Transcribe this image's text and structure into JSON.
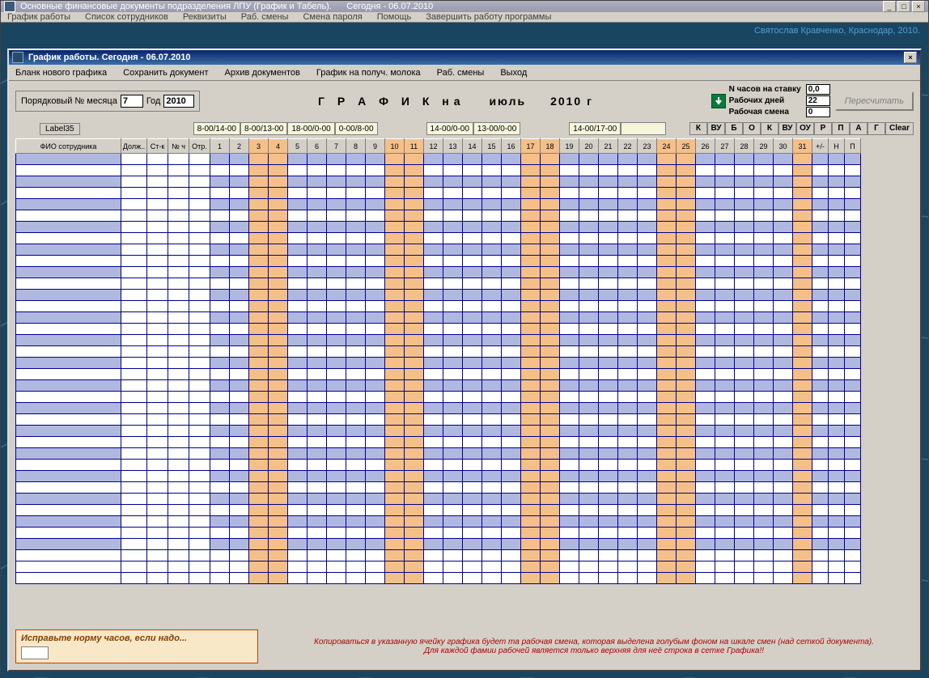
{
  "outer": {
    "title": "Основные финансовые документы подразделения ЛПУ (График и Табель).",
    "date_label": "Сегодня - 06.07.2010",
    "menu": [
      "График работы",
      "Список сотрудников",
      "Реквизиты",
      "Раб. смены",
      "Смена пароля",
      "Помощь",
      "Завершить работу программы"
    ]
  },
  "credit": "Святослав Кравченко, Краснодар, 2010.",
  "inner": {
    "title": "График работы.    Сегодня - 06.07.2010",
    "menu": [
      "Бланк нового графика",
      "Сохранить документ",
      "Архив документов",
      "График на получ. молока",
      "Раб. смены",
      "Выход"
    ]
  },
  "fields": {
    "month_label": "Порядковый № месяца",
    "month_value": "7",
    "year_label": "Год",
    "year_value": "2010",
    "main_title": "Г Р А Ф И К  на",
    "month_name": "июль",
    "year_text": "2010 г"
  },
  "stats": {
    "hours_label": "N часов на ставку",
    "hours_value": "0,0",
    "days_label": "Рабочих дней",
    "days_value": "22",
    "shift_label": "Рабочая смена",
    "shift_value": "0"
  },
  "recalc": "Пересчитать",
  "label35": "Label35",
  "shifts": [
    "8-00/14-00",
    "8-00/13-00",
    "18-00/0-00",
    "0-00/8-00",
    "14-00/0-00",
    "13-00/0-00",
    "14-00/17-00"
  ],
  "codes": [
    "К",
    "ВУ",
    "Б",
    "О",
    "К",
    "ВУ",
    "ОУ",
    "Р",
    "П",
    "А",
    "Г"
  ],
  "clear": "Clear",
  "grid_headers": {
    "fio": "ФИО сотрудника",
    "pos": "Долж..",
    "rate": "Ст-к",
    "hours": "№ ч",
    "dep": "Отр.",
    "pm": "+/-",
    "n": "Н",
    "p": "П"
  },
  "days": [
    1,
    2,
    3,
    4,
    5,
    6,
    7,
    8,
    9,
    10,
    11,
    12,
    13,
    14,
    15,
    16,
    17,
    18,
    19,
    20,
    21,
    22,
    23,
    24,
    25,
    26,
    27,
    28,
    29,
    30,
    31
  ],
  "weekend_days": [
    3,
    4,
    10,
    11,
    17,
    18,
    24,
    25,
    31
  ],
  "norm_label": "Исправьте норму часов, если надо...",
  "hint1": "Копироваться в указанную ячейку графика будет та рабочая смена, которая выделена голубым фоном на шкале смен (над сеткой документа).",
  "hint2": "Для каждой фамии рабочей является только верхняя для неё строка в сетке Графика!!"
}
